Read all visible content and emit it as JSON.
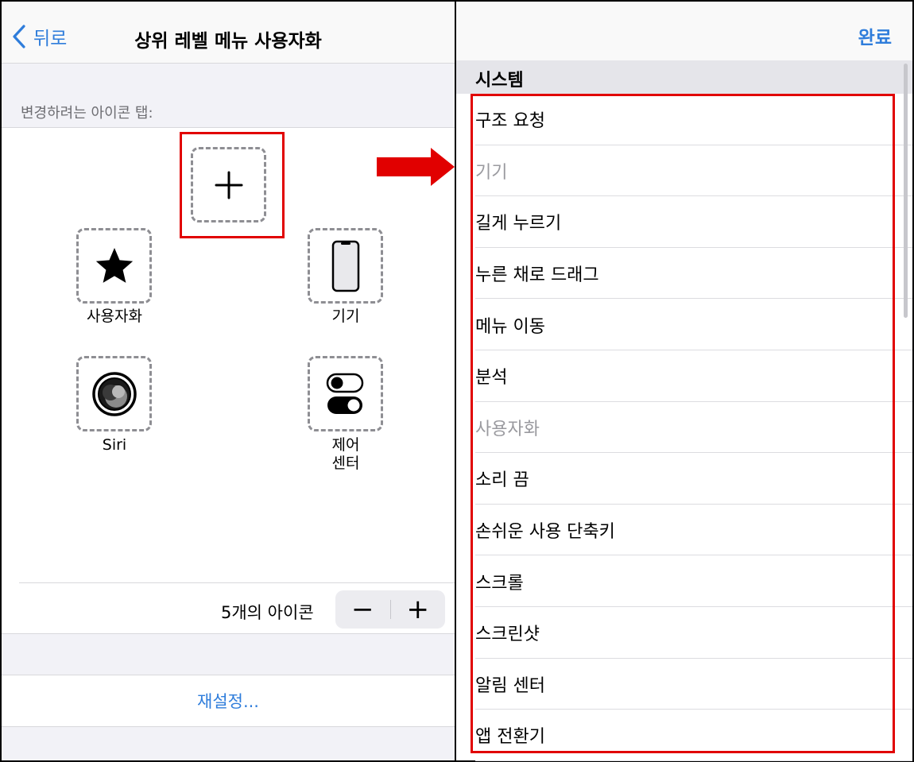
{
  "left_nav": {
    "back_label": "뒤로",
    "title": "상위 레벨 메뉴 사용자화"
  },
  "section_label": "변경하려는 아이콘 탭:",
  "slots": {
    "top": {
      "label": "",
      "icon": "plus-icon"
    },
    "customize": {
      "label": "사용자화",
      "icon": "star-icon"
    },
    "device": {
      "label": "기기",
      "icon": "iphone-icon"
    },
    "siri": {
      "label": "Siri",
      "icon": "siri-icon"
    },
    "control": {
      "label": "제어\n센터",
      "icon": "toggle-switches-icon"
    }
  },
  "icon_count": "5개의 아이콘",
  "stepper": {
    "minus": "−",
    "plus": "+"
  },
  "reset_label": "재설정...",
  "right_nav": {
    "done_label": "완료"
  },
  "list_section": "시스템",
  "list_items": [
    {
      "label": "구조 요청",
      "enabled": true
    },
    {
      "label": "기기",
      "enabled": false
    },
    {
      "label": "길게 누르기",
      "enabled": true
    },
    {
      "label": "누른 채로 드래그",
      "enabled": true
    },
    {
      "label": "메뉴 이동",
      "enabled": true
    },
    {
      "label": "분석",
      "enabled": true
    },
    {
      "label": "사용자화",
      "enabled": false
    },
    {
      "label": "소리 끔",
      "enabled": true
    },
    {
      "label": "손쉬운 사용 단축키",
      "enabled": true
    },
    {
      "label": "스크롤",
      "enabled": true
    },
    {
      "label": "스크린샷",
      "enabled": true
    },
    {
      "label": "알림 센터",
      "enabled": true
    },
    {
      "label": "앱 전환기",
      "enabled": true
    }
  ],
  "colors": {
    "accent": "#2f7ddb",
    "highlight": "#e10000",
    "disabled_text": "#9a9a9f"
  }
}
